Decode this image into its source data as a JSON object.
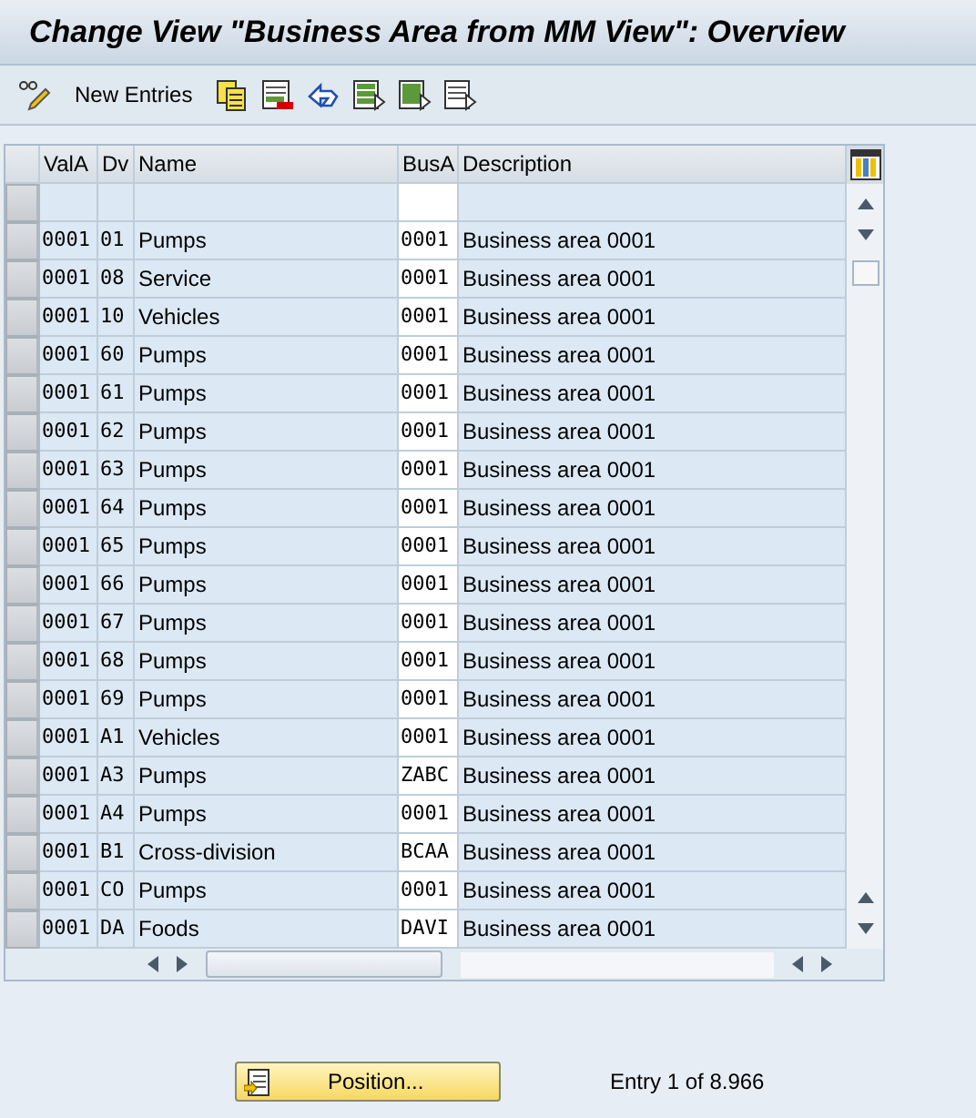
{
  "window": {
    "title": "Change View \"Business Area from MM View\": Overview"
  },
  "toolbar": [
    {
      "kind": "toggle-edit"
    },
    {
      "kind": "text",
      "label": "New Entries"
    },
    {
      "kind": "copy"
    },
    {
      "kind": "delete"
    },
    {
      "kind": "undo"
    },
    {
      "kind": "select-all"
    },
    {
      "kind": "select-block"
    },
    {
      "kind": "deselect"
    }
  ],
  "table": {
    "columns": [
      "ValA",
      "Dv",
      "Name",
      "BusA",
      "Description"
    ],
    "rows": [
      {
        "vala": "0001",
        "dv": "01",
        "name": "Pumps",
        "busa": "0001",
        "description": "Business area 0001"
      },
      {
        "vala": "0001",
        "dv": "08",
        "name": "Service",
        "busa": "0001",
        "description": "Business area 0001"
      },
      {
        "vala": "0001",
        "dv": "10",
        "name": "Vehicles",
        "busa": "0001",
        "description": "Business area 0001"
      },
      {
        "vala": "0001",
        "dv": "60",
        "name": "Pumps",
        "busa": "0001",
        "description": "Business area 0001"
      },
      {
        "vala": "0001",
        "dv": "61",
        "name": "Pumps",
        "busa": "0001",
        "description": "Business area 0001"
      },
      {
        "vala": "0001",
        "dv": "62",
        "name": "Pumps",
        "busa": "0001",
        "description": "Business area 0001"
      },
      {
        "vala": "0001",
        "dv": "63",
        "name": "Pumps",
        "busa": "0001",
        "description": "Business area 0001"
      },
      {
        "vala": "0001",
        "dv": "64",
        "name": "Pumps",
        "busa": "0001",
        "description": "Business area 0001"
      },
      {
        "vala": "0001",
        "dv": "65",
        "name": "Pumps",
        "busa": "0001",
        "description": "Business area 0001"
      },
      {
        "vala": "0001",
        "dv": "66",
        "name": "Pumps",
        "busa": "0001",
        "description": "Business area 0001"
      },
      {
        "vala": "0001",
        "dv": "67",
        "name": "Pumps",
        "busa": "0001",
        "description": "Business area 0001"
      },
      {
        "vala": "0001",
        "dv": "68",
        "name": "Pumps",
        "busa": "0001",
        "description": "Business area 0001"
      },
      {
        "vala": "0001",
        "dv": "69",
        "name": "Pumps",
        "busa": "0001",
        "description": "Business area 0001"
      },
      {
        "vala": "0001",
        "dv": "A1",
        "name": "Vehicles",
        "busa": "0001",
        "description": "Business area 0001"
      },
      {
        "vala": "0001",
        "dv": "A3",
        "name": "Pumps",
        "busa": "ZABC",
        "description": "Business area 0001"
      },
      {
        "vala": "0001",
        "dv": "A4",
        "name": "Pumps",
        "busa": "0001",
        "description": "Business area 0001"
      },
      {
        "vala": "0001",
        "dv": "B1",
        "name": "Cross-division",
        "busa": "BCAA",
        "description": "Business area 0001"
      },
      {
        "vala": "0001",
        "dv": "CO",
        "name": "Pumps",
        "busa": "0001",
        "description": "Business area 0001"
      },
      {
        "vala": "0001",
        "dv": "DA",
        "name": "Foods",
        "busa": "DAVI",
        "description": "Business area 0001"
      }
    ]
  },
  "footer": {
    "position_button": "Position...",
    "entry_info": "Entry 1 of 8.966"
  }
}
